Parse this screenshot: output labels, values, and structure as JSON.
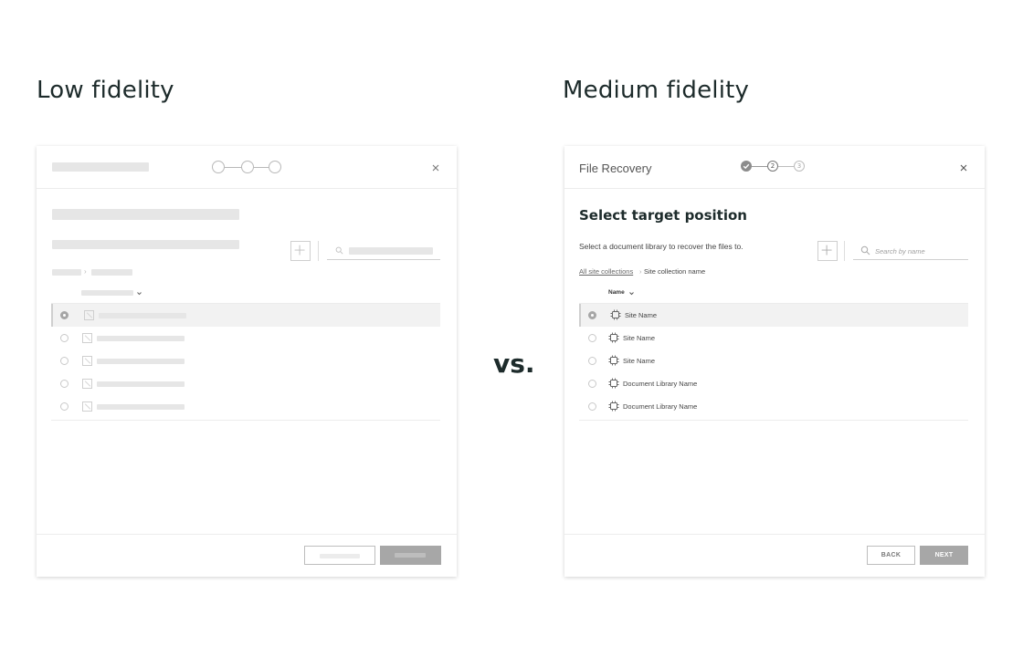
{
  "titles": {
    "low": "Low fidelity",
    "medium": "Medium fidelity",
    "vs": "vs."
  },
  "dialog": {
    "title": "File Recovery",
    "close_icon": "close-icon",
    "steps": [
      "2",
      "3"
    ],
    "heading": "Select target position",
    "description": "Select a document library to recover the files to.",
    "add_icon": "plus-icon",
    "search": {
      "placeholder": "Search by name",
      "icon": "search-icon"
    },
    "breadcrumb": {
      "root": "All site collections",
      "separator": "›",
      "current": "Site collection name"
    },
    "column_header": "Name",
    "sort_icon": "chevron-down-icon",
    "rows": [
      {
        "label": "Site Name",
        "selected": true
      },
      {
        "label": "Site Name",
        "selected": false
      },
      {
        "label": "Site Name",
        "selected": false
      },
      {
        "label": "Document Library Name",
        "selected": false
      },
      {
        "label": "Document Library Name",
        "selected": false
      }
    ],
    "buttons": {
      "back": "BACK",
      "next": "NEXT"
    }
  },
  "colors": {
    "heading": "#1d2b2b",
    "placeholder_bar": "#e6e6e6",
    "primary_button": "#a7a7a7"
  }
}
